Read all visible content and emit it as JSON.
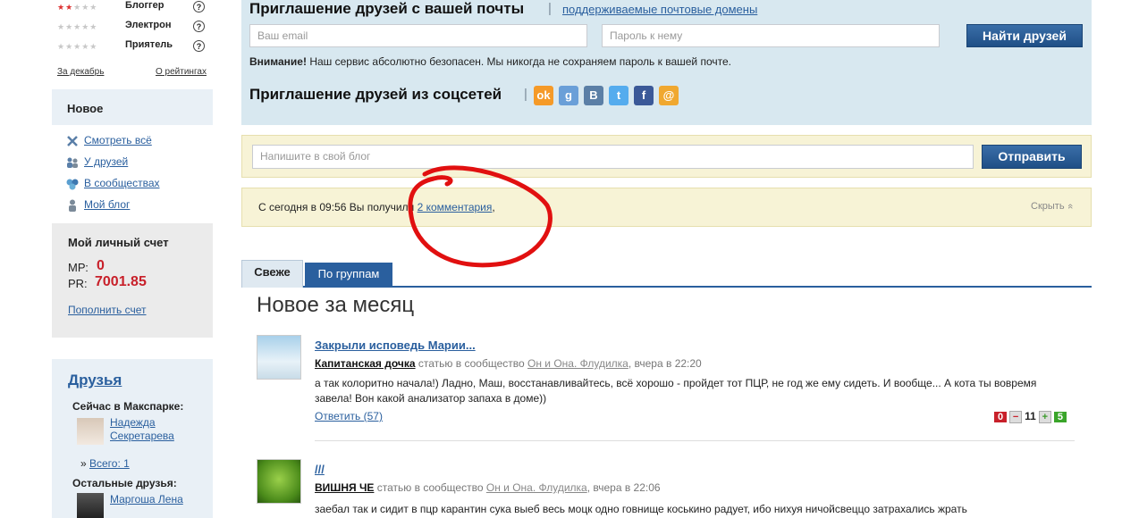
{
  "sidebar": {
    "ratings": [
      {
        "label": "Блоггер",
        "filled": 2
      },
      {
        "label": "Электрон",
        "filled": 0
      },
      {
        "label": "Приятель",
        "filled": 0
      }
    ],
    "help_glyph": "?",
    "stars_full": "★★★★★",
    "december_link": "За декабрь",
    "about_ratings_link": "О рейтингах",
    "new_section": {
      "title": "Новое",
      "items": [
        {
          "label": "Смотреть всё",
          "icon": "cross-icon"
        },
        {
          "label": "У друзей",
          "icon": "friends-icon"
        },
        {
          "label": "В сообществах",
          "icon": "community-icon"
        },
        {
          "label": "Мой блог",
          "icon": "person-icon"
        }
      ]
    },
    "account": {
      "title": "Мой личный счет",
      "mp_label": "МР:",
      "mp_value": "0",
      "pr_label": "PR:",
      "pr_value": "7001.85",
      "topup_link": "Пополнить счет"
    },
    "friends": {
      "title": "Друзья",
      "online_label": "Сейчас в Макспарке:",
      "online_friend_line1": "Надежда",
      "online_friend_line2": "Секретарева",
      "total_prefix": "»",
      "total_link": "Всего: 1",
      "other_label": "Остальные друзья:",
      "other_friend": "Маргоша Лена"
    }
  },
  "invite": {
    "title": "Приглашение друзей с вашей почты",
    "separator": "|",
    "domains_link": "поддерживаемые почтовые домены",
    "email_placeholder": "Ваш email",
    "password_placeholder": "Пароль к нему",
    "find_button": "Найти друзей",
    "notice_bold": "Внимание!",
    "notice_text": "Наш сервис абсолютно безопасен. Мы никогда не сохраняем пароль к вашей почте.",
    "social_title": "Приглашение друзей из соцсетей",
    "social_icons": [
      {
        "name": "odnoklassniki-icon",
        "glyph": "ok",
        "color": "#f59a28"
      },
      {
        "name": "google-icon",
        "glyph": "g",
        "color": "#6a9fd8"
      },
      {
        "name": "vkontakte-icon",
        "glyph": "B",
        "color": "#5b7fa6"
      },
      {
        "name": "twitter-icon",
        "glyph": "t",
        "color": "#55acee"
      },
      {
        "name": "facebook-icon",
        "glyph": "f",
        "color": "#3b5998"
      },
      {
        "name": "mail-icon",
        "glyph": "@",
        "color": "#f0a830"
      }
    ]
  },
  "blog": {
    "placeholder": "Напишите в свой блог",
    "send_button": "Отправить"
  },
  "notification": {
    "text_before": "С сегодня в 09:56 Вы получили",
    "comments_link": "2 комментария",
    "text_after": ",",
    "hide_label": "Скрыть",
    "hide_icon": "«"
  },
  "tabs": [
    {
      "label": "Свеже",
      "active": true
    },
    {
      "label": "По группам",
      "active": false
    }
  ],
  "feed": {
    "heading": "Новое за месяц",
    "posts": [
      {
        "title": "Закрыли исповедь Марии...",
        "author": "Капитанская дочка",
        "meta_prefix": "статью в сообщество",
        "community": "Он и Она. Флудилка",
        "time": "вчера в 22:20",
        "text": "а так колоритно начала!) Ладно, Маш, восстанавливайтесь, всё хорошо - пройдет тот ПЦР, не год же ему сидеть. И вообще... А кота ты вовремя завела! Вон какой анализатор запаха в доме))",
        "reply": "Ответить (57)",
        "minus_count": "0",
        "score": "11",
        "plus_count": "5"
      },
      {
        "title": "///",
        "author": "ВИШНЯ ЧЕ",
        "meta_prefix": "статью в сообщество",
        "community": "Он и Она. Флудилка",
        "time": "вчера в 22:06",
        "text": "заебал так и сидит в пцр карантин сука выеб весь моцк одно говнище коськино радует, ибо нихуя ничойсвеццо затрахались жрать"
      }
    ]
  },
  "colors": {
    "accent": "#2a5f9e",
    "annotation_red": "#e11010",
    "invite_bg": "#d8e8f0",
    "notice_bg": "#f7f3d6"
  }
}
